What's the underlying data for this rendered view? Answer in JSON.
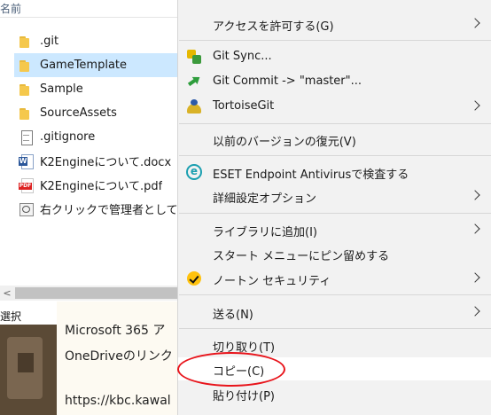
{
  "explorer": {
    "column_header": "名前",
    "files": [
      {
        "name": ".git",
        "icon": "folder-icon",
        "selected": false
      },
      {
        "name": "GameTemplate",
        "icon": "folder-icon",
        "selected": true
      },
      {
        "name": "Sample",
        "icon": "folder-icon",
        "selected": false
      },
      {
        "name": "SourceAssets",
        "icon": "folder-icon",
        "selected": false
      },
      {
        "name": ".gitignore",
        "icon": "text-file-icon",
        "selected": false
      },
      {
        "name": "K2Engineについて.docx",
        "icon": "word-file-icon",
        "selected": false
      },
      {
        "name": "K2Engineについて.pdf",
        "icon": "pdf-file-icon",
        "selected": false
      },
      {
        "name": "右クリックで管理者として実",
        "icon": "shortcut-icon",
        "selected": false
      }
    ],
    "status_text": "選択"
  },
  "background_document": {
    "lines": [
      "Microsoft 365 ア",
      "OneDriveのリンク",
      "https://kbc.kawal"
    ]
  },
  "context_menu": {
    "items": [
      {
        "label": "アクセスを許可する(G)",
        "submenu": true
      },
      {
        "label": "Git Sync...",
        "icon": "git-sync-icon",
        "submenu": false
      },
      {
        "label": "Git Commit -> \"master\"...",
        "icon": "git-commit-icon",
        "submenu": false
      },
      {
        "label": "TortoiseGit",
        "icon": "tortoisegit-icon",
        "submenu": true
      },
      {
        "label": "以前のバージョンの復元(V)",
        "submenu": false
      },
      {
        "label": "ESET Endpoint Antivirusで検査する",
        "icon": "eset-icon",
        "submenu": false
      },
      {
        "label": "詳細設定オプション",
        "submenu": true
      },
      {
        "label": "ライブラリに追加(I)",
        "submenu": true
      },
      {
        "label": "スタート メニューにピン留めする",
        "submenu": false
      },
      {
        "label": "ノートン セキュリティ",
        "icon": "norton-icon",
        "submenu": true
      },
      {
        "label": "送る(N)",
        "submenu": true
      },
      {
        "label": "切り取り(T)",
        "submenu": false
      },
      {
        "label": "コピー(C)",
        "submenu": false,
        "hovered": true
      },
      {
        "label": "貼り付け(P)",
        "submenu": false
      }
    ]
  },
  "colors": {
    "selection": "#cce8ff",
    "menu_background": "#f2f2f2",
    "menu_hover": "#ffffff",
    "annotation_circle": "#e8141b"
  }
}
